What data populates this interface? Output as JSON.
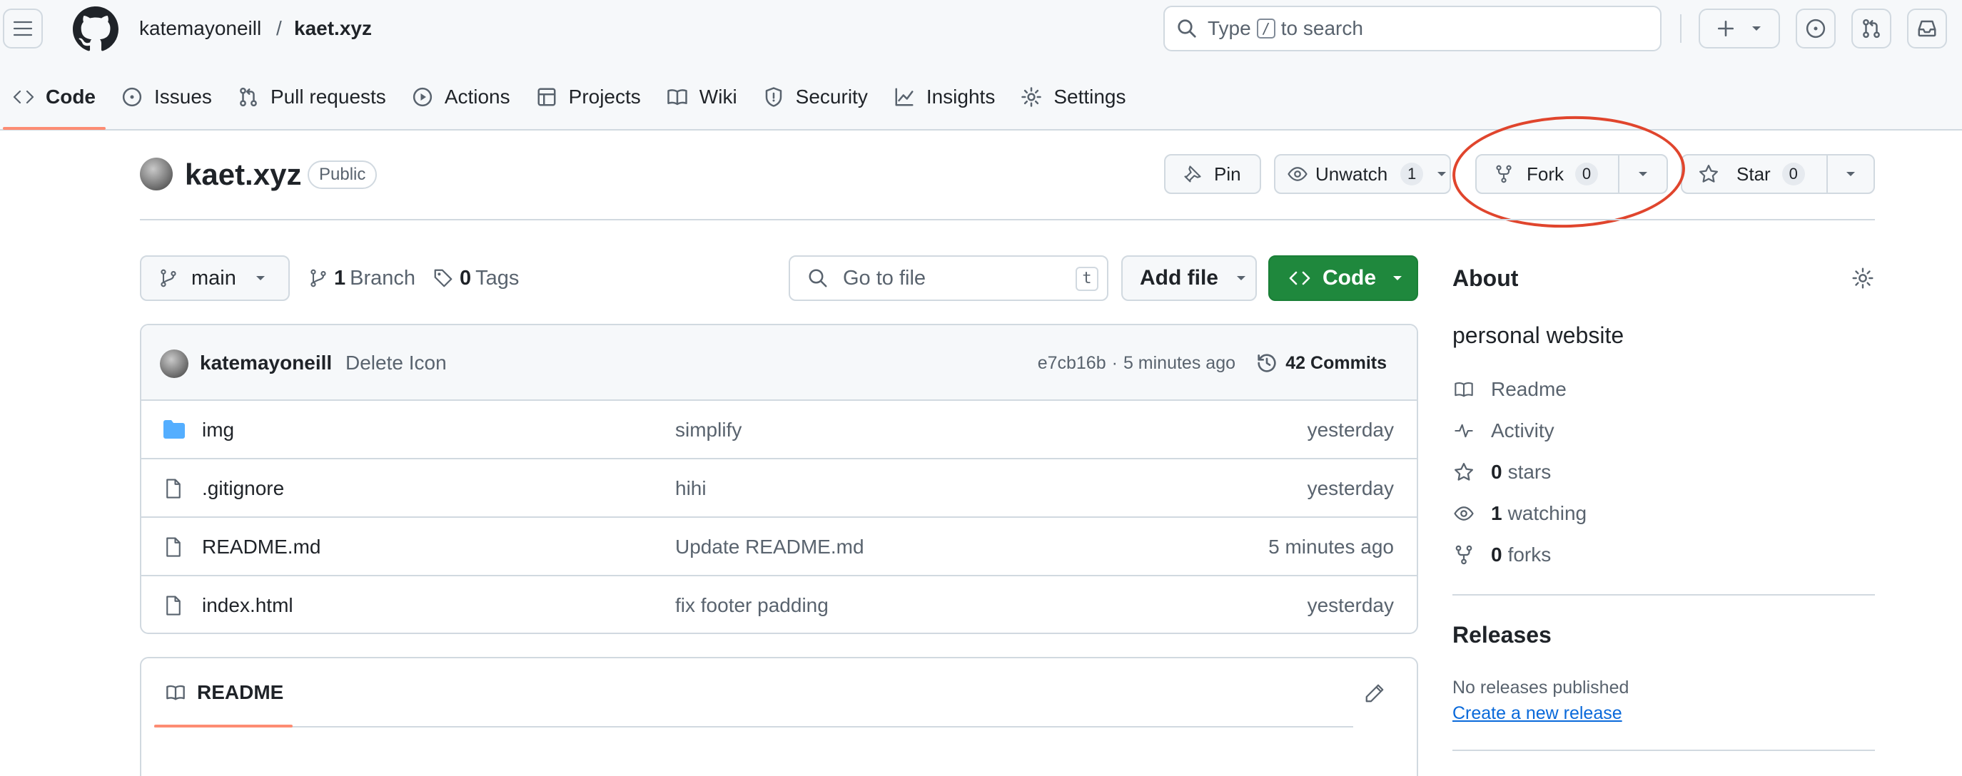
{
  "header": {
    "owner": "katemayoneill",
    "separator": "/",
    "repo": "kaet.xyz",
    "search": {
      "prefix": "Type",
      "key": "/",
      "suffix": "to search"
    }
  },
  "nav": {
    "tabs": [
      {
        "label": "Code",
        "icon": "code-icon",
        "active": true
      },
      {
        "label": "Issues",
        "icon": "issue-icon"
      },
      {
        "label": "Pull requests",
        "icon": "pull-request-icon"
      },
      {
        "label": "Actions",
        "icon": "play-icon"
      },
      {
        "label": "Projects",
        "icon": "table-icon"
      },
      {
        "label": "Wiki",
        "icon": "book-icon"
      },
      {
        "label": "Security",
        "icon": "shield-icon"
      },
      {
        "label": "Insights",
        "icon": "graph-icon"
      },
      {
        "label": "Settings",
        "icon": "gear-icon"
      }
    ]
  },
  "repo": {
    "name": "kaet.xyz",
    "visibility": "Public",
    "pin_label": "Pin",
    "unwatch_label": "Unwatch",
    "watch_count": "1",
    "fork_label": "Fork",
    "fork_count": "0",
    "star_label": "Star",
    "star_count": "0"
  },
  "toolbar": {
    "branch": "main",
    "branch_count": "1",
    "branch_label": "Branch",
    "tag_count": "0",
    "tag_label": "Tags",
    "goto_placeholder": "Go to file",
    "goto_key": "t",
    "add_file_label": "Add file",
    "code_label": "Code"
  },
  "commit": {
    "author": "katemayoneill",
    "message": "Delete Icon",
    "hash": "e7cb16b",
    "dot": "·",
    "time": "5 minutes ago",
    "commits_label": "42 Commits"
  },
  "files": [
    {
      "name": "img",
      "type": "folder",
      "message": "simplify",
      "date": "yesterday"
    },
    {
      "name": ".gitignore",
      "type": "file",
      "message": "hihi",
      "date": "yesterday"
    },
    {
      "name": "README.md",
      "type": "file",
      "message": "Update README.md",
      "date": "5 minutes ago"
    },
    {
      "name": "index.html",
      "type": "file",
      "message": "fix footer padding",
      "date": "yesterday"
    }
  ],
  "readme": {
    "tab_label": "README"
  },
  "sidebar": {
    "about_title": "About",
    "description": "personal website",
    "readme_label": "Readme",
    "activity_label": "Activity",
    "stars_count": "0",
    "stars_label": "stars",
    "watching_count": "1",
    "watching_label": "watching",
    "forks_count": "0",
    "forks_label": "forks",
    "releases_title": "Releases",
    "no_releases": "No releases published",
    "create_release": "Create a new release"
  },
  "colors": {
    "accent_green": "#1f883d",
    "nav_underline": "#fd8c73",
    "link_blue": "#0969da",
    "highlight_red": "#e0452d",
    "folder_blue": "#54aeff"
  }
}
